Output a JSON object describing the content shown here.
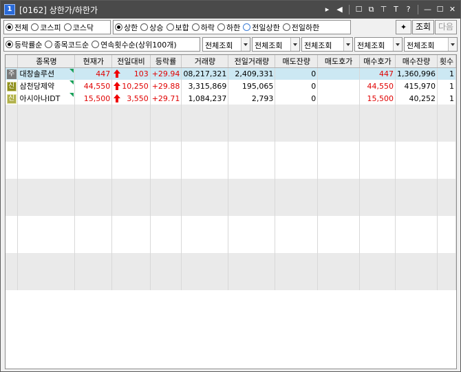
{
  "window": {
    "badge": "1",
    "title": "[0162] 상한가/하한가",
    "controls": [
      "▸",
      "◀",
      "☐",
      "⧉",
      "⊤",
      "T",
      "?",
      "—",
      "☐",
      "✕"
    ]
  },
  "filters": {
    "market": {
      "options": [
        "전체",
        "코스피",
        "코스닥"
      ],
      "selected": "전체"
    },
    "limit": {
      "options": [
        "상한",
        "상승",
        "보합",
        "하락",
        "하한",
        "전일상한",
        "전일하한"
      ],
      "selected": "상한"
    },
    "buttons": {
      "icon": "✦",
      "search": "조회",
      "next": "다음"
    }
  },
  "sort": {
    "options": [
      "등락률순",
      "종목코드순",
      "연속횟수순(상위100개)"
    ],
    "selected": "등락률순",
    "combos": [
      "전체조회",
      "전체조회",
      "전체조회",
      "전체조회",
      "전체조회"
    ]
  },
  "table": {
    "headers": [
      "종목명",
      "현재가",
      "전일대비",
      "등락률",
      "거래량",
      "전일거래량",
      "매도잔량",
      "매도호가",
      "매수호가",
      "매수잔량",
      "횟수"
    ],
    "rows": [
      {
        "mark": "주",
        "mark_style": "gray",
        "name": "대창솔루션",
        "price": "447",
        "change": "103",
        "rate": "+29.94",
        "volume": "08,217,321",
        "prev_volume": "2,409,331",
        "ask_qty": "0",
        "ask_price": "",
        "bid_price": "447",
        "bid_qty": "1,360,996",
        "count": "1"
      },
      {
        "mark": "신",
        "mark_style": "olive",
        "name": "삼천당제약",
        "price": "44,550",
        "change": "10,250",
        "rate": "+29.88",
        "volume": "3,315,869",
        "prev_volume": "195,065",
        "ask_qty": "0",
        "ask_price": "",
        "bid_price": "44,550",
        "bid_qty": "415,970",
        "count": "1"
      },
      {
        "mark": "신",
        "mark_style": "lightolive",
        "name": "아시아나IDT",
        "price": "15,500",
        "change": "3,550",
        "rate": "+29.71",
        "volume": "1,084,237",
        "prev_volume": "2,793",
        "ask_qty": "0",
        "ask_price": "",
        "bid_price": "15,500",
        "bid_qty": "40,252",
        "count": "1"
      }
    ]
  }
}
